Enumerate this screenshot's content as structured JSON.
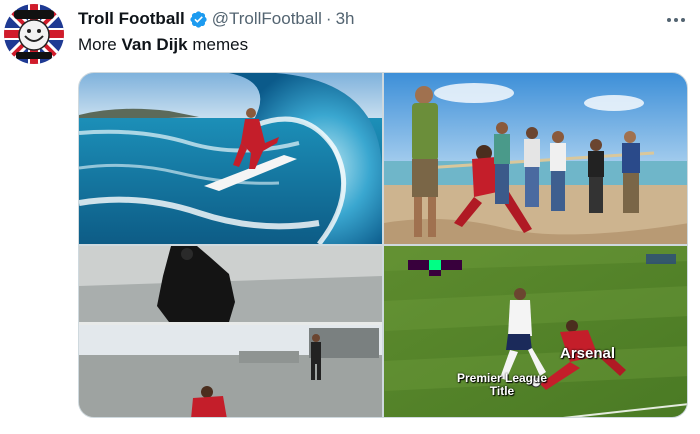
{
  "tweet": {
    "author_name": "Troll Football",
    "handle": "@TrollFootball",
    "separator": "·",
    "time": "3h",
    "text_prefix": "More ",
    "text_bold": "Van Dijk",
    "text_suffix": " memes"
  },
  "media": {
    "labels": {
      "arsenal": "Arsenal",
      "premier_league_title": "Premier League Title"
    }
  },
  "colors": {
    "verified": "#1d9bf0",
    "text_primary": "#0f1419",
    "text_secondary": "#536471",
    "border": "#cfd9de"
  }
}
